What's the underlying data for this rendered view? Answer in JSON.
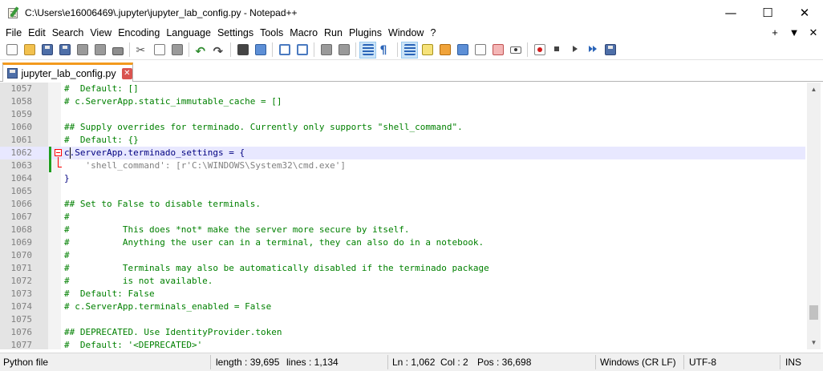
{
  "window": {
    "title": "C:\\Users\\e16006469\\.jupyter\\jupyter_lab_config.py - Notepad++",
    "minimize": "—",
    "maximize": "☐",
    "close": "✕"
  },
  "menu": {
    "items": [
      {
        "label": "File"
      },
      {
        "label": "Edit"
      },
      {
        "label": "Search"
      },
      {
        "label": "View"
      },
      {
        "label": "Encoding"
      },
      {
        "label": "Language"
      },
      {
        "label": "Settings"
      },
      {
        "label": "Tools"
      },
      {
        "label": "Macro"
      },
      {
        "label": "Run"
      },
      {
        "label": "Plugins"
      },
      {
        "label": "Window"
      },
      {
        "label": "?"
      }
    ],
    "plus": "+",
    "dropdown": "▼",
    "close": "✕"
  },
  "tab": {
    "label": "jupyter_lab_config.py",
    "close": "✕"
  },
  "editor": {
    "lines": [
      {
        "num": "1057",
        "text": "#  Default: []",
        "type": "comment"
      },
      {
        "num": "1058",
        "text": "# c.ServerApp.static_immutable_cache = []",
        "type": "comment"
      },
      {
        "num": "1059",
        "text": "",
        "type": "comment"
      },
      {
        "num": "1060",
        "text": "## Supply overrides for terminado. Currently only supports \"shell_command\".",
        "type": "comment"
      },
      {
        "num": "1061",
        "text": "#  Default: {}",
        "type": "comment"
      },
      {
        "num": "1062",
        "text": "c.ServerApp.terminado_settings = {",
        "type": "code"
      },
      {
        "num": "1063",
        "text": "    'shell_command': [r'C:\\WINDOWS\\System32\\cmd.exe']",
        "type": "string"
      },
      {
        "num": "1064",
        "text": "}",
        "type": "code"
      },
      {
        "num": "1065",
        "text": "",
        "type": "comment"
      },
      {
        "num": "1066",
        "text": "## Set to False to disable terminals.",
        "type": "comment"
      },
      {
        "num": "1067",
        "text": "#",
        "type": "comment"
      },
      {
        "num": "1068",
        "text": "#          This does *not* make the server more secure by itself.",
        "type": "comment"
      },
      {
        "num": "1069",
        "text": "#          Anything the user can in a terminal, they can also do in a notebook.",
        "type": "comment"
      },
      {
        "num": "1070",
        "text": "#",
        "type": "comment"
      },
      {
        "num": "1071",
        "text": "#          Terminals may also be automatically disabled if the terminado package",
        "type": "comment"
      },
      {
        "num": "1072",
        "text": "#          is not available.",
        "type": "comment"
      },
      {
        "num": "1073",
        "text": "#  Default: False",
        "type": "comment"
      },
      {
        "num": "1074",
        "text": "# c.ServerApp.terminals_enabled = False",
        "type": "comment"
      },
      {
        "num": "1075",
        "text": "",
        "type": "comment"
      },
      {
        "num": "1076",
        "text": "## DEPRECATED. Use IdentityProvider.token",
        "type": "comment"
      },
      {
        "num": "1077",
        "text": "#  Default: '<DEPRECATED>'",
        "type": "comment"
      }
    ],
    "current_line_index": 5
  },
  "status": {
    "file_type": "Python file",
    "length": "length : 39,695",
    "lines": "lines : 1,134",
    "ln": "Ln : 1,062",
    "col": "Col : 2",
    "pos": "Pos : 36,698",
    "eol": "Windows (CR LF)",
    "encoding": "UTF-8",
    "mode": "INS"
  },
  "colors": {
    "comment": "#008000",
    "code": "#000080",
    "string": "#808080",
    "current_line": "#e8e8ff",
    "tab_accent": "#f39a1e",
    "change_bar": "#1e9e1e",
    "fold_marker": "#ff0000"
  },
  "icons": {
    "toolbar": [
      "new-file-icon",
      "open-file-icon",
      "save-icon",
      "save-all-icon",
      "close-icon",
      "close-all-icon",
      "print-icon",
      "cut-icon",
      "copy-icon",
      "paste-icon",
      "undo-icon",
      "redo-icon",
      "find-icon",
      "replace-icon",
      "zoom-in-icon",
      "zoom-out-icon",
      "sync-vertical-icon",
      "sync-horizontal-icon",
      "word-wrap-icon",
      "show-all-characters-icon",
      "indent-guide-icon",
      "user-defined-language-icon",
      "document-map-icon",
      "document-list-icon",
      "function-list-icon",
      "folder-as-workspace-icon",
      "monitoring-icon",
      "record-macro-icon",
      "stop-recording-icon",
      "playback-macro-icon",
      "run-macro-multiple-icon",
      "save-macro-icon"
    ]
  }
}
